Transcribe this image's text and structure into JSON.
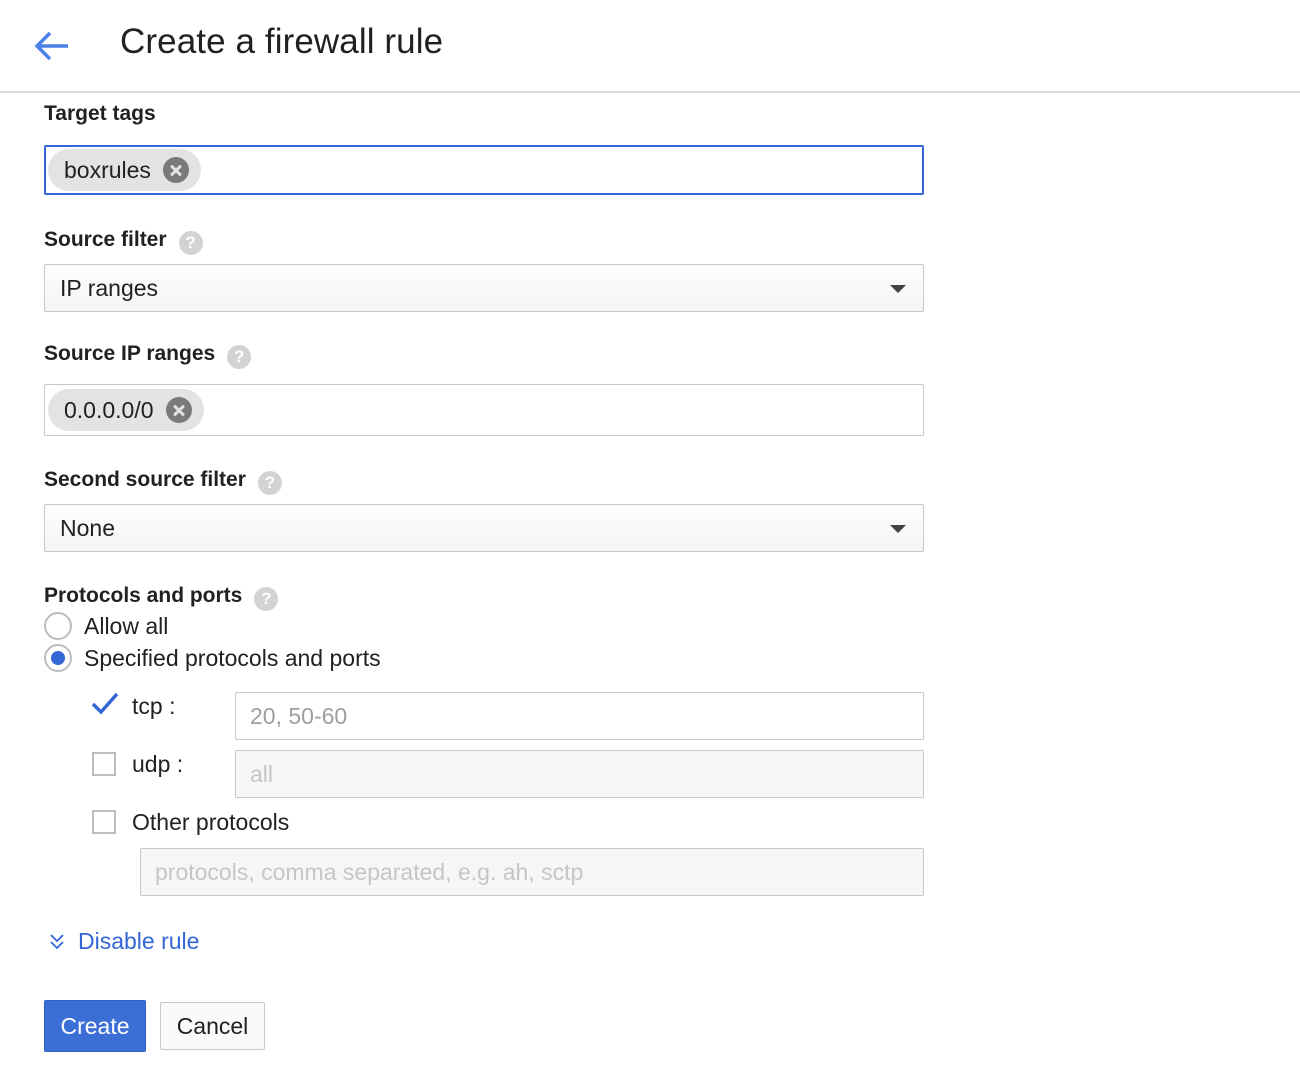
{
  "header": {
    "title": "Create a firewall rule"
  },
  "target_tags": {
    "label": "Target tags",
    "chips": [
      "boxrules"
    ]
  },
  "source_filter": {
    "label": "Source filter",
    "value": "IP ranges",
    "help": "?"
  },
  "source_ip_ranges": {
    "label": "Source IP ranges",
    "chips": [
      "0.0.0.0/0"
    ],
    "help": "?"
  },
  "second_source_filter": {
    "label": "Second source filter",
    "value": "None",
    "help": "?"
  },
  "protocols": {
    "label": "Protocols and ports",
    "help": "?",
    "options": [
      {
        "label": "Allow all",
        "selected": false
      },
      {
        "label": "Specified protocols and ports",
        "selected": true
      }
    ],
    "tcp": {
      "label": "tcp :",
      "checked": true,
      "placeholder": "20, 50-60"
    },
    "udp": {
      "label": "udp :",
      "checked": false,
      "placeholder": "all"
    },
    "other": {
      "label": "Other protocols",
      "checked": false,
      "placeholder": "protocols, comma separated, e.g. ah, sctp"
    }
  },
  "disable_rule": {
    "label": "Disable rule"
  },
  "actions": {
    "create": "Create",
    "cancel": "Cancel"
  },
  "colors": {
    "accent": "#3367d6",
    "create_button": "#3b6fd6"
  },
  "icons": [
    "back-arrow-icon",
    "help-icon",
    "chip-remove-icon",
    "dropdown-caret-icon",
    "checkmark-icon",
    "chevron-down-icon"
  ]
}
